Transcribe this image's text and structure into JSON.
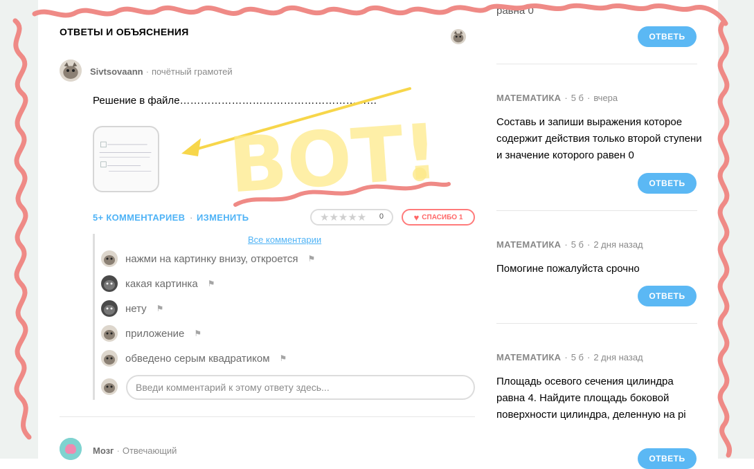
{
  "section_title": "ОТВЕТЫ И ОБЪЯСНЕНИЯ",
  "answer": {
    "author": "Sivtsovaann",
    "author_rank": "почётный грамотей",
    "text": "Решение в файле…………………………………………………",
    "comments_link": "5+ КОММЕНТАРИЕВ",
    "edit_link": "ИЗМЕНИТЬ",
    "rating_count": "0",
    "thanks_label": "СПАСИБО 1",
    "all_comments": "Все комментарии",
    "comments": [
      {
        "text": "нажми на картинку внизу, откроется"
      },
      {
        "text": "какая картинка"
      },
      {
        "text": "нету"
      },
      {
        "text": "приложение"
      },
      {
        "text": "обведено серым квадратиком"
      }
    ],
    "comment_placeholder": "Введи комментарий к этому ответу здесь..."
  },
  "next_answer": {
    "author": "Мозг",
    "author_rank": "Отвечающий"
  },
  "overlay_text": "ВОТ!",
  "sidebar": {
    "top_cut_text": "равна 0",
    "questions": [
      {
        "subject": "МАТЕМАТИКА",
        "points": "5 б",
        "time": "вчера",
        "text": "Составь и запиши выражения которое содержит действия только второй ступени и значение которого равен 0"
      },
      {
        "subject": "МАТЕМАТИКА",
        "points": "5 б",
        "time": "2 дня назад",
        "text": "Помогине пожалуйста срочно"
      },
      {
        "subject": "МАТЕМАТИКА",
        "points": "5 б",
        "time": "2 дня назад",
        "text": "Площадь осевого сечения цилиндра равна 4. Найдите площадь боковой поверхности цилиндра, деленную на pi"
      }
    ],
    "answer_label": "ОТВЕТЬ"
  },
  "colors": {
    "accent_blue": "#4fb3f6",
    "button_blue": "#5bb8f4",
    "thanks_red": "#ff6767",
    "scribble_red": "#ef8a86",
    "annotation_yellow": "#f7d64a"
  }
}
